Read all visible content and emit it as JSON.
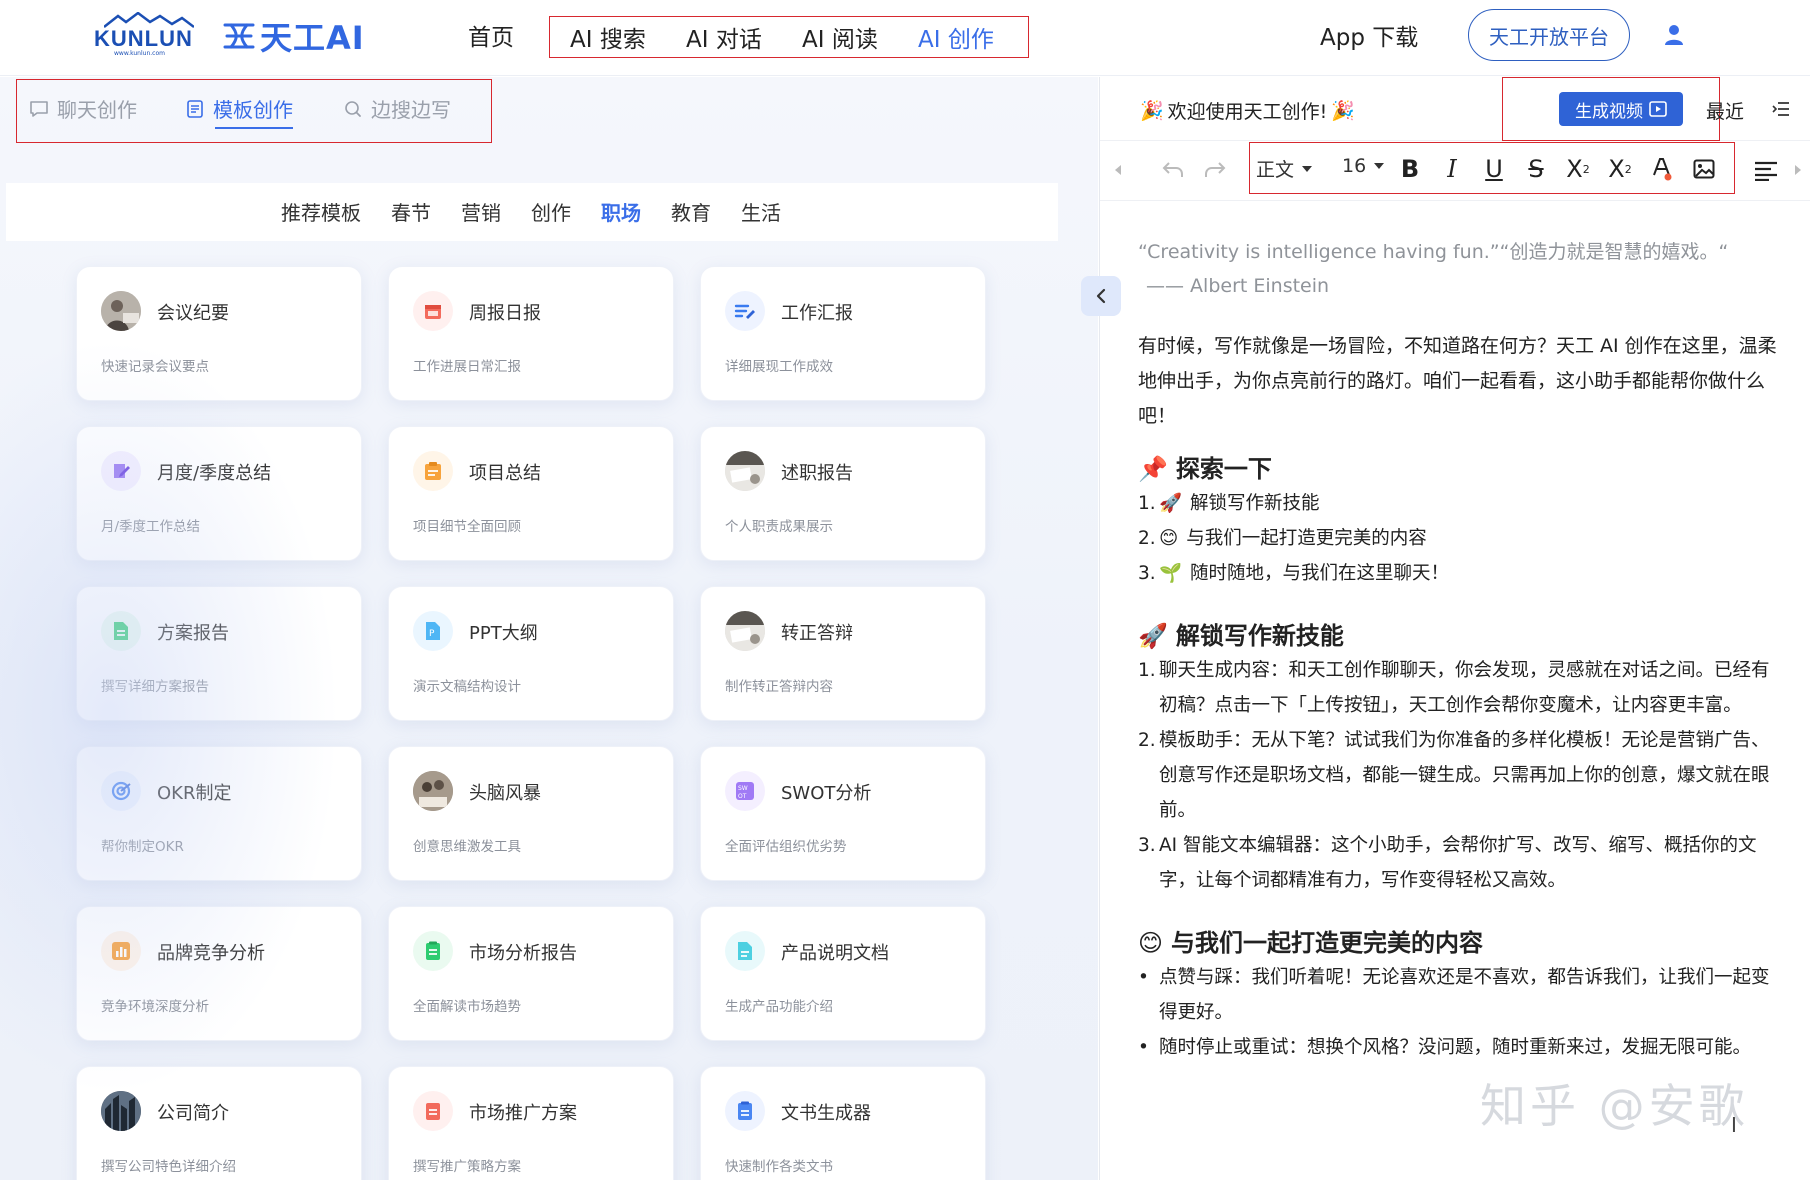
{
  "logo": {
    "kunlun": "KUNLUN",
    "kunlun_url": "www.kunlun.com",
    "product": "天工AI"
  },
  "nav": {
    "home": "首页",
    "items": [
      {
        "label": "AI 搜索",
        "active": false
      },
      {
        "label": "AI 对话",
        "active": false
      },
      {
        "label": "AI 阅读",
        "active": false
      },
      {
        "label": "AI 创作",
        "active": true
      }
    ],
    "app_download": "App 下载",
    "open_platform": "天工开放平台"
  },
  "mode_tabs": [
    {
      "label": "聊天创作",
      "icon": "chat-bubble-icon",
      "active": false
    },
    {
      "label": "模板创作",
      "icon": "template-doc-icon",
      "active": true
    },
    {
      "label": "边搜边写",
      "icon": "search-icon",
      "active": false
    }
  ],
  "categories": [
    {
      "label": "推荐模板",
      "active": false
    },
    {
      "label": "春节",
      "active": false
    },
    {
      "label": "营销",
      "active": false
    },
    {
      "label": "创作",
      "active": false
    },
    {
      "label": "职场",
      "active": true
    },
    {
      "label": "教育",
      "active": false
    },
    {
      "label": "生活",
      "active": false
    }
  ],
  "cards": [
    {
      "title": "会议纪要",
      "desc": "快速记录会议要点",
      "icon": "meeting-photo-icon"
    },
    {
      "title": "周报日报",
      "desc": "工作进展日常汇报",
      "icon": "calendar-icon"
    },
    {
      "title": "工作汇报",
      "desc": "详细展现工作成效",
      "icon": "report-pen-icon"
    },
    {
      "title": "月度/季度总结",
      "desc": "月/季度工作总结",
      "icon": "note-edit-icon"
    },
    {
      "title": "项目总结",
      "desc": "项目细节全面回顾",
      "icon": "clipboard-icon"
    },
    {
      "title": "述职报告",
      "desc": "个人职责成果展示",
      "icon": "desk-photo-icon"
    },
    {
      "title": "方案报告",
      "desc": "撰写详细方案报告",
      "icon": "green-doc-icon"
    },
    {
      "title": "PPT大纲",
      "desc": "演示文稿结构设计",
      "icon": "ppt-file-icon"
    },
    {
      "title": "转正答辩",
      "desc": "制作转正答辩内容",
      "icon": "desk-photo-icon"
    },
    {
      "title": "OKR制定",
      "desc": "帮你制定OKR",
      "icon": "target-icon"
    },
    {
      "title": "头脑风暴",
      "desc": "创意思维激发工具",
      "icon": "brainstorm-photo-icon"
    },
    {
      "title": "SWOT分析",
      "desc": "全面评估组织优劣势",
      "icon": "swot-icon"
    },
    {
      "title": "品牌竞争分析",
      "desc": "竞争环境深度分析",
      "icon": "bar-chart-icon"
    },
    {
      "title": "市场分析报告",
      "desc": "全面解读市场趋势",
      "icon": "green-list-icon"
    },
    {
      "title": "产品说明文档",
      "desc": "生成产品功能介绍",
      "icon": "cyan-doc-icon"
    },
    {
      "title": "公司简介",
      "desc": "撰写公司特色详细介绍",
      "icon": "city-photo-icon"
    },
    {
      "title": "市场推广方案",
      "desc": "撰写推广策略方案",
      "icon": "red-doc-icon"
    },
    {
      "title": "文书生成器",
      "desc": "快速制作各类文书",
      "icon": "blue-doc-icon"
    }
  ],
  "editor": {
    "welcome": "欢迎使用天工创作!",
    "generate_video": "生成视频",
    "recent": "最近",
    "toolbar": {
      "style": "正文",
      "size": "16"
    },
    "quote": "“Creativity is intelligence having fun.”“创造力就是智慧的嬉戏。“",
    "quote_author": "—— Albert Einstein",
    "intro": "有时候，写作就像是一场冒险，不知道路在何方？天工 AI 创作在这里，温柔地伸出手，为你点亮前行的路灯。咱们一起看看，这小助手都能帮你做什么吧！",
    "explore_title": "探索一下",
    "explore_items": [
      {
        "num": "1.",
        "emoji": "🚀",
        "text": "解锁写作新技能"
      },
      {
        "num": "2.",
        "emoji": "😊",
        "text": "与我们一起打造更完美的内容"
      },
      {
        "num": "3.",
        "emoji": "🌱",
        "text": "随时随地，与我们在这里聊天！"
      }
    ],
    "unlock_title": "解锁写作新技能",
    "unlock_items": [
      {
        "num": "1.",
        "text": "聊天生成内容：和天工创作聊聊天，你会发现，灵感就在对话之间。已经有初稿？点击一下「上传按钮」，天工创作会帮你变魔术，让内容更丰富。"
      },
      {
        "num": "2.",
        "text": "模板助手：无从下笔？试试我们为你准备的多样化模板！无论是营销广告、创意写作还是职场文档，都能一键生成。只需再加上你的创意，爆文就在眼前。"
      },
      {
        "num": "3.",
        "text": "AI 智能文本编辑器：这个小助手，会帮你扩写、改写、缩写、概括你的文字，让每个词都精准有力，写作变得轻松又高效。"
      }
    ],
    "perfect_title": "与我们一起打造更完美的内容",
    "perfect_items": [
      {
        "num": "•",
        "text": "点赞与踩：我们听着呢！无论喜欢还是不喜欢，都告诉我们，让我们一起变得更好。"
      },
      {
        "num": "•",
        "text": "随时停止或重试：想换个风格？没问题，随时重新来过，发掘无限可能。"
      }
    ]
  },
  "watermark": "知乎 @安歌",
  "colors": {
    "accent": "#3a6ee8",
    "brand_dark": "#1b4fb4",
    "highlight_box": "#d7282f",
    "button": "#2f63d6"
  }
}
